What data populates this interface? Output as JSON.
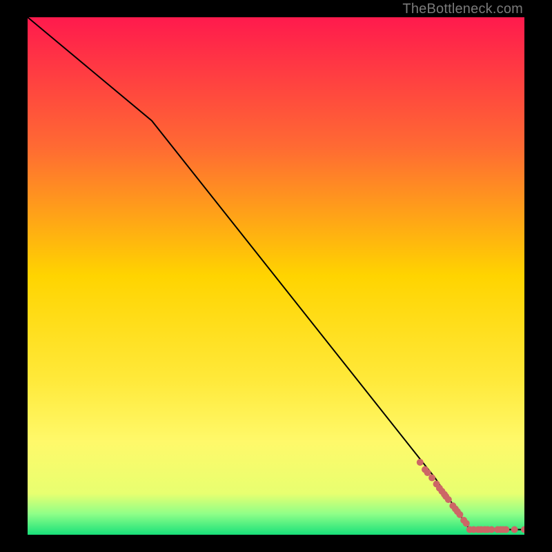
{
  "attribution": "TheBottleneck.com",
  "chart_data": {
    "type": "line",
    "title": "",
    "xlabel": "",
    "ylabel": "",
    "xlim": [
      0,
      100
    ],
    "ylim": [
      0,
      100
    ],
    "background_gradient": {
      "stops": [
        {
          "pct": 0,
          "color": "#ff1a4d"
        },
        {
          "pct": 25,
          "color": "#ff6a33"
        },
        {
          "pct": 50,
          "color": "#ffd400"
        },
        {
          "pct": 70,
          "color": "#ffe93a"
        },
        {
          "pct": 82,
          "color": "#fff96a"
        },
        {
          "pct": 92,
          "color": "#e8ff70"
        },
        {
          "pct": 96,
          "color": "#8eff88"
        },
        {
          "pct": 100,
          "color": "#18e07a"
        }
      ]
    },
    "series": [
      {
        "name": "bottleneck-curve",
        "color": "#000000",
        "points": [
          {
            "x": 0,
            "y": 100
          },
          {
            "x": 25,
            "y": 80
          },
          {
            "x": 82,
            "y": 11
          },
          {
            "x": 89,
            "y": 1
          },
          {
            "x": 100,
            "y": 1
          }
        ]
      }
    ],
    "scatter": {
      "name": "data-points",
      "color": "#cc6666",
      "radius": 5,
      "points": [
        {
          "x": 79,
          "y": 14
        },
        {
          "x": 80,
          "y": 12.6
        },
        {
          "x": 80.5,
          "y": 12
        },
        {
          "x": 81.4,
          "y": 11
        },
        {
          "x": 82.3,
          "y": 9.8
        },
        {
          "x": 82.9,
          "y": 9
        },
        {
          "x": 83.4,
          "y": 8.4
        },
        {
          "x": 83.9,
          "y": 7.8
        },
        {
          "x": 84.2,
          "y": 7.4
        },
        {
          "x": 84.7,
          "y": 6.8
        },
        {
          "x": 85.6,
          "y": 5.6
        },
        {
          "x": 86.1,
          "y": 5.0
        },
        {
          "x": 86.5,
          "y": 4.5
        },
        {
          "x": 87.0,
          "y": 3.9
        },
        {
          "x": 87.8,
          "y": 2.8
        },
        {
          "x": 88.3,
          "y": 2.2
        },
        {
          "x": 89.0,
          "y": 1.0
        },
        {
          "x": 89.8,
          "y": 1.0
        },
        {
          "x": 90.7,
          "y": 1.0
        },
        {
          "x": 91.3,
          "y": 1.0
        },
        {
          "x": 92.0,
          "y": 1.0
        },
        {
          "x": 92.6,
          "y": 1.0
        },
        {
          "x": 93.4,
          "y": 1.0
        },
        {
          "x": 94.6,
          "y": 1.0
        },
        {
          "x": 95.2,
          "y": 1.0
        },
        {
          "x": 95.7,
          "y": 1.0
        },
        {
          "x": 96.3,
          "y": 1.0
        },
        {
          "x": 98.0,
          "y": 1.0
        },
        {
          "x": 100.0,
          "y": 1.0
        }
      ]
    }
  }
}
